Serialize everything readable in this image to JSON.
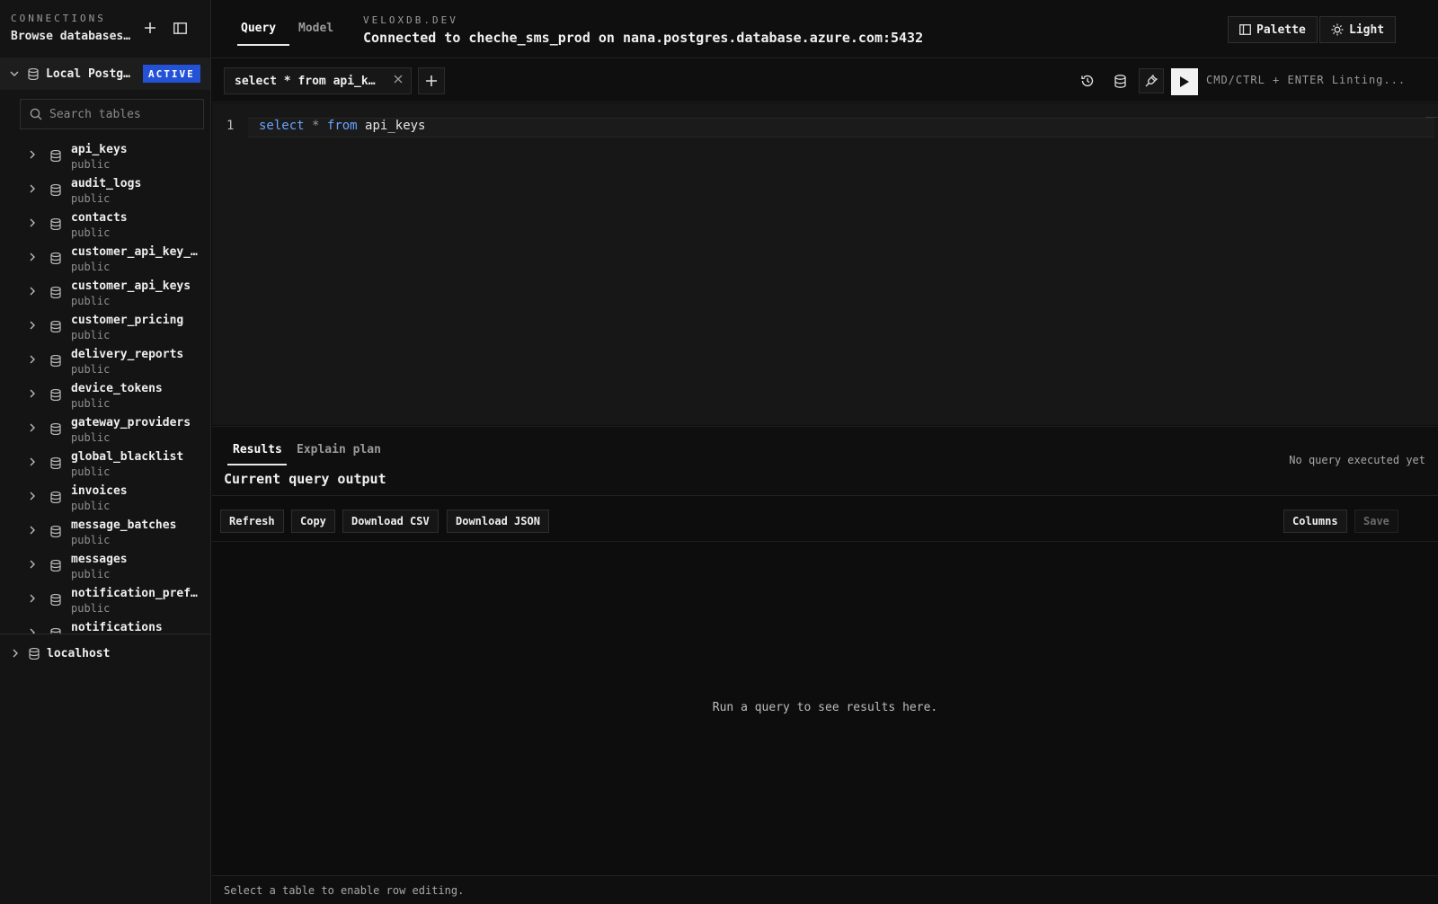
{
  "sidebar": {
    "title": "CONNECTIONS",
    "subtitle": "Browse databases…",
    "active_connection": {
      "name": "Local Postg…",
      "badge": "ACTIVE"
    },
    "search_placeholder": "Search tables",
    "tables": [
      {
        "name": "api_keys",
        "schema": "public"
      },
      {
        "name": "audit_logs",
        "schema": "public"
      },
      {
        "name": "contacts",
        "schema": "public"
      },
      {
        "name": "customer_api_key_…",
        "schema": "public"
      },
      {
        "name": "customer_api_keys",
        "schema": "public"
      },
      {
        "name": "customer_pricing",
        "schema": "public"
      },
      {
        "name": "delivery_reports",
        "schema": "public"
      },
      {
        "name": "device_tokens",
        "schema": "public"
      },
      {
        "name": "gateway_providers",
        "schema": "public"
      },
      {
        "name": "global_blacklist",
        "schema": "public"
      },
      {
        "name": "invoices",
        "schema": "public"
      },
      {
        "name": "message_batches",
        "schema": "public"
      },
      {
        "name": "messages",
        "schema": "public"
      },
      {
        "name": "notification_pref…",
        "schema": "public"
      },
      {
        "name": "notifications",
        "schema": "public"
      }
    ],
    "other_connection": {
      "name": "localhost"
    }
  },
  "header": {
    "tabs": [
      {
        "label": "Query"
      },
      {
        "label": "Model"
      }
    ],
    "brand": "VELOXDB.DEV",
    "connection_info": "Connected to cheche_sms_prod on nana.postgres.database.azure.com:5432",
    "palette_label": "Palette",
    "theme_label": "Light"
  },
  "editor": {
    "tab_label": "select * from api_k…",
    "hint": "CMD/CTRL + ENTER Linting...",
    "line_number": "1",
    "code": {
      "kw1": "select",
      "star": "*",
      "kw2": "from",
      "ident": "api_keys"
    }
  },
  "results": {
    "tabs": [
      {
        "label": "Results"
      },
      {
        "label": "Explain plan"
      }
    ],
    "title": "Current query output",
    "status": "No query executed yet",
    "actions": {
      "refresh": "Refresh",
      "copy": "Copy",
      "download_csv": "Download CSV",
      "download_json": "Download JSON",
      "columns": "Columns",
      "save": "Save"
    },
    "empty_message": "Run a query to see results here.",
    "footer": "Select a table to enable row editing."
  },
  "colors": {
    "accent": "#2452d6",
    "keyword": "#6aa3ff",
    "background": "#0d0d0d",
    "sidebar": "#141414"
  }
}
